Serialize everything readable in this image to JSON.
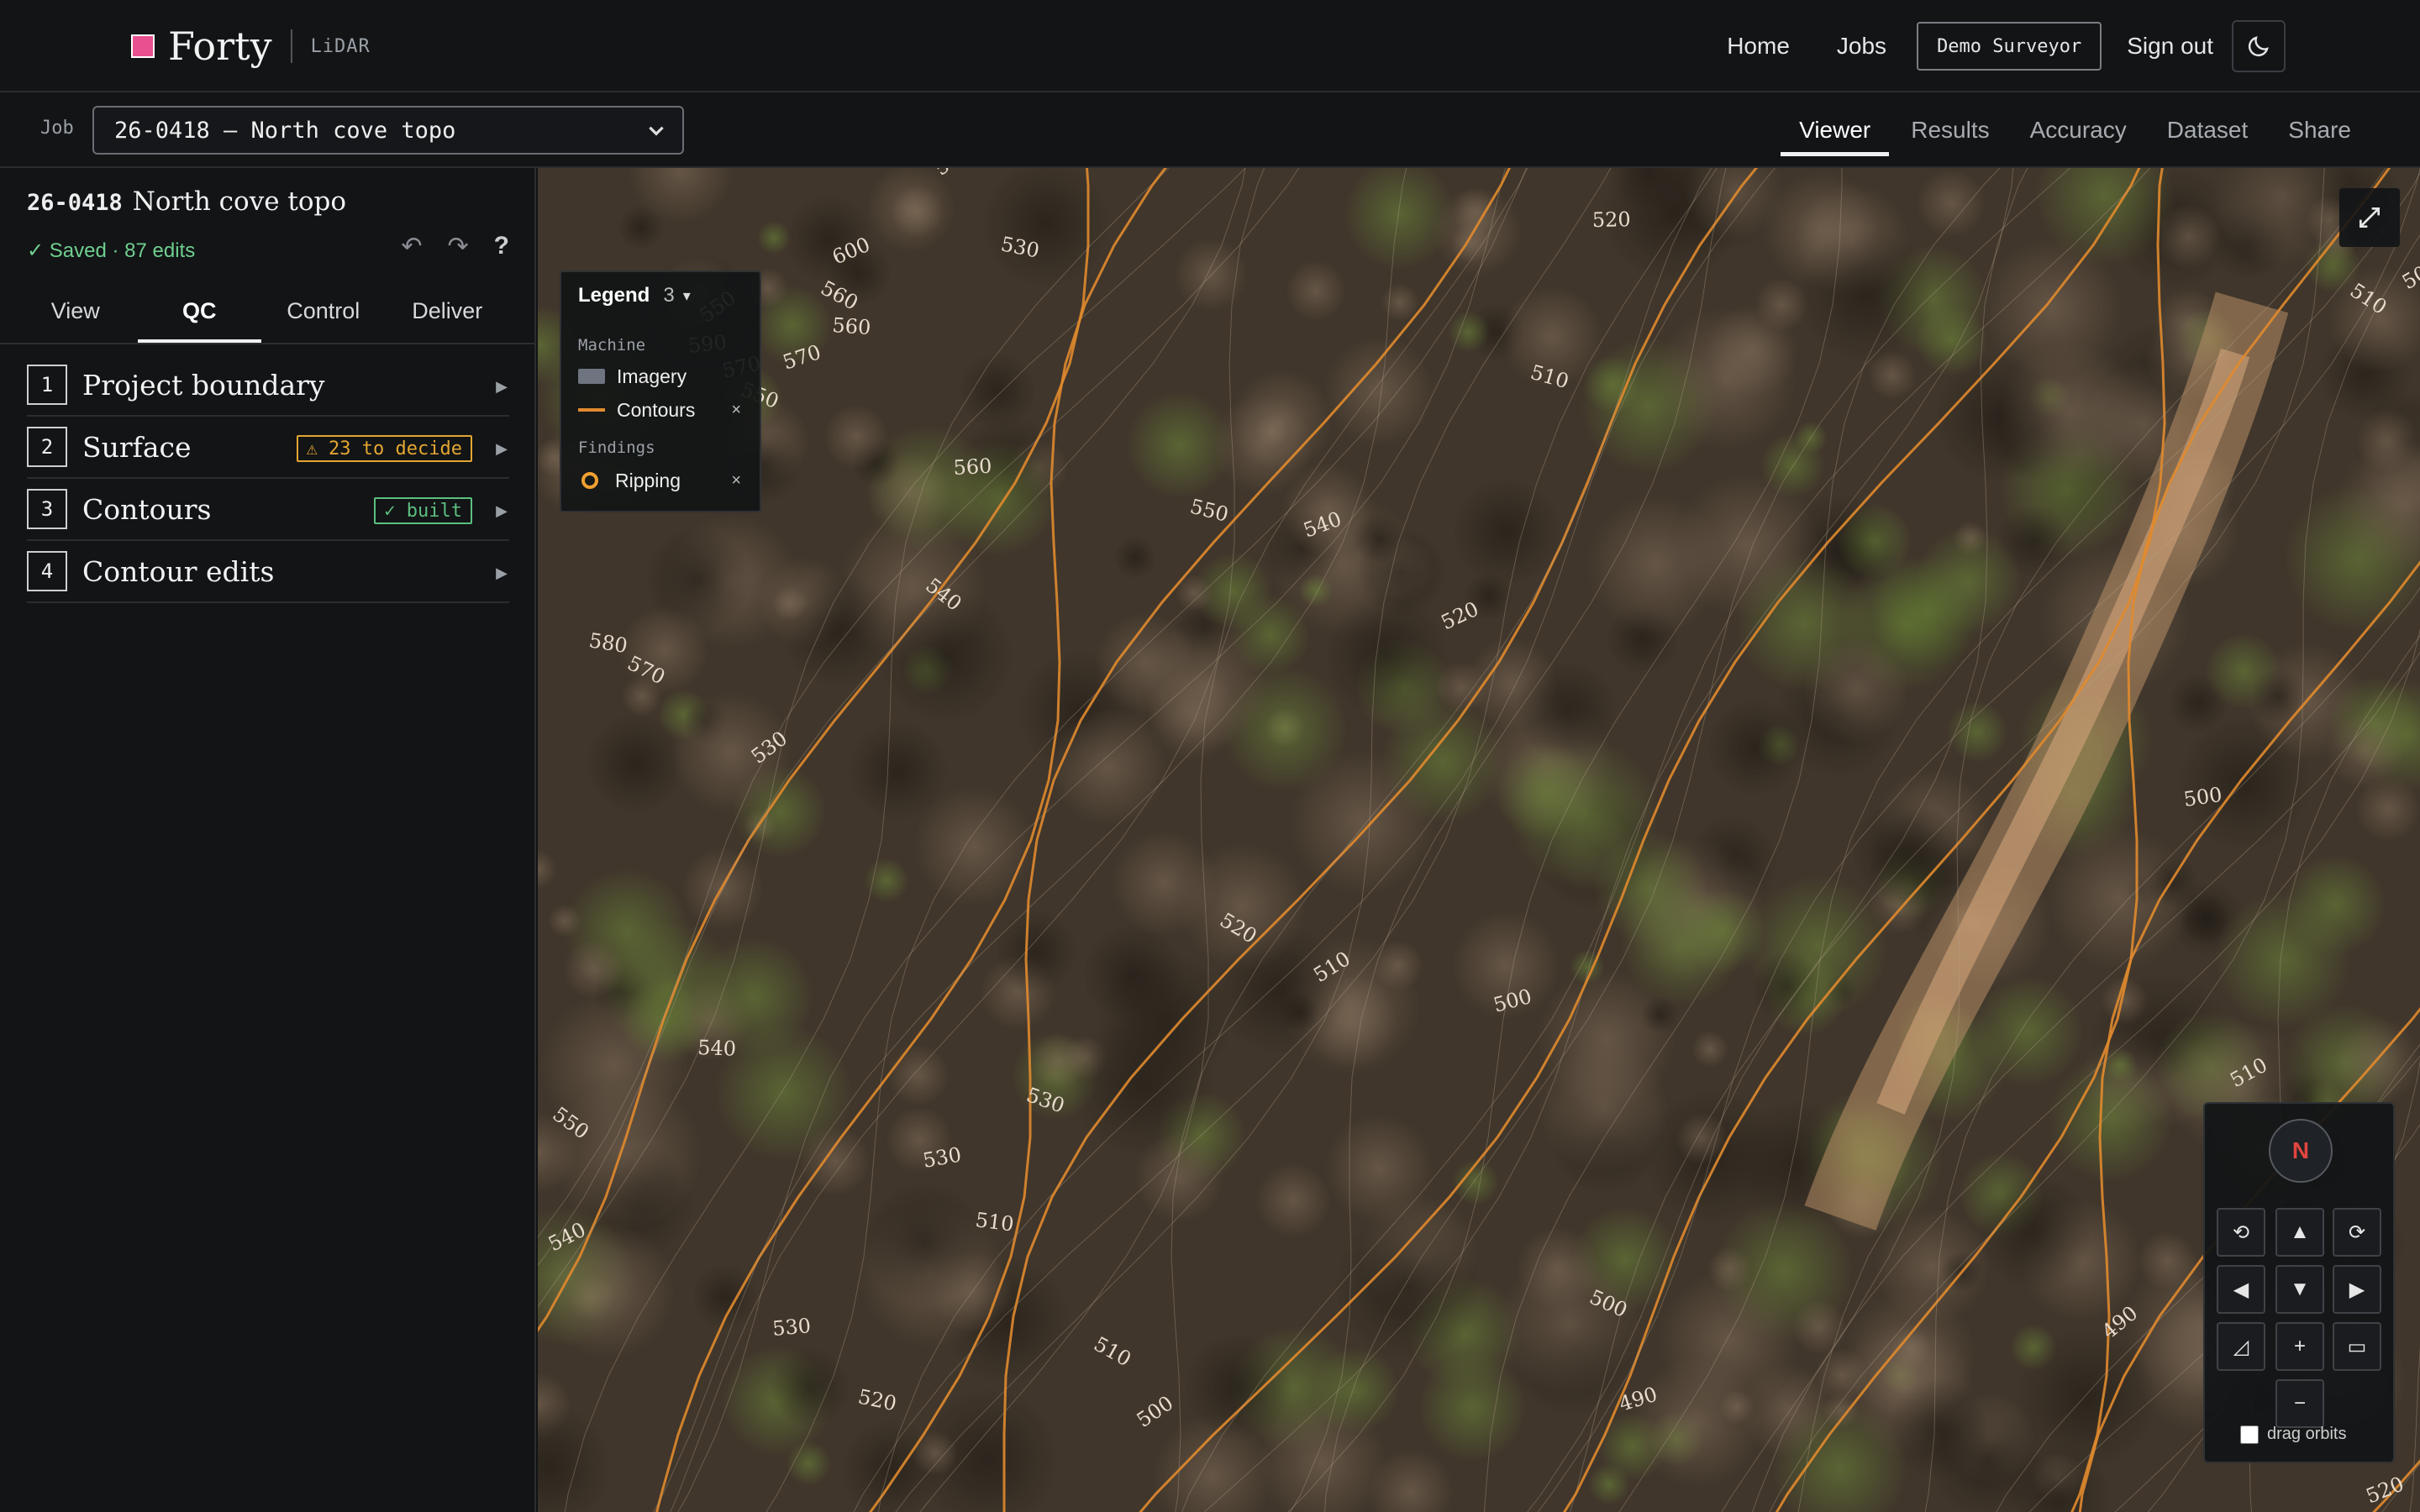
{
  "brand": {
    "name": "Forty",
    "sub": "LiDAR",
    "color": "#e8508f"
  },
  "topnav": {
    "home": "Home",
    "jobs": "Jobs",
    "user": "Demo Surveyor",
    "signout": "Sign out",
    "theme_icon": "moon-icon"
  },
  "job": {
    "label": "Job",
    "selected": "26-0418 — North cove topo"
  },
  "tabs": [
    "Viewer",
    "Results",
    "Accuracy",
    "Dataset",
    "Share"
  ],
  "sidebar": {
    "code": "26-0418",
    "name": "North cove topo",
    "saved": "✓ Saved · 87 edits",
    "undo": "↶",
    "redo": "↷",
    "help": "?",
    "tabs": [
      "View",
      "QC",
      "Control",
      "Deliver"
    ],
    "steps": [
      {
        "num": "1",
        "label": "Project boundary",
        "badge": ""
      },
      {
        "num": "2",
        "label": "Surface",
        "badge": "⚠ 23 to decide"
      },
      {
        "num": "3",
        "label": "Contours",
        "badge": "✓ built"
      },
      {
        "num": "4",
        "label": "Contour edits",
        "badge": ""
      }
    ]
  },
  "legend": {
    "title": "Legend",
    "count": "3",
    "caret": "▾",
    "machine_label": "Machine",
    "imagery": "Imagery",
    "contours": "Contours",
    "findings_label": "Findings",
    "ripping": "Ripping",
    "close": "×"
  },
  "contour_labels": [
    "590",
    "600",
    "590",
    "530",
    "560",
    "550",
    "570",
    "520",
    "510",
    "510",
    "500",
    "570",
    "560",
    "550",
    "540",
    "520",
    "500",
    "580",
    "570",
    "530",
    "540",
    "560",
    "550",
    "520",
    "510",
    "500",
    "540",
    "530",
    "550",
    "540",
    "530",
    "510",
    "500",
    "490",
    "520",
    "530",
    "520",
    "510",
    "500",
    "490",
    "520",
    "490",
    "490",
    "510"
  ],
  "navpad": {
    "north": "N",
    "rot_left": "⟲",
    "up": "▲",
    "rot_right": "⟳",
    "left": "◀",
    "down": "▼",
    "right": "▶",
    "tilt": "◿",
    "zoom_in": "+",
    "flat": "▭",
    "zoom_out": "−",
    "drag_orbits": "drag orbits"
  },
  "colors": {
    "contour": "#e08a2e",
    "bg": "#121416"
  }
}
